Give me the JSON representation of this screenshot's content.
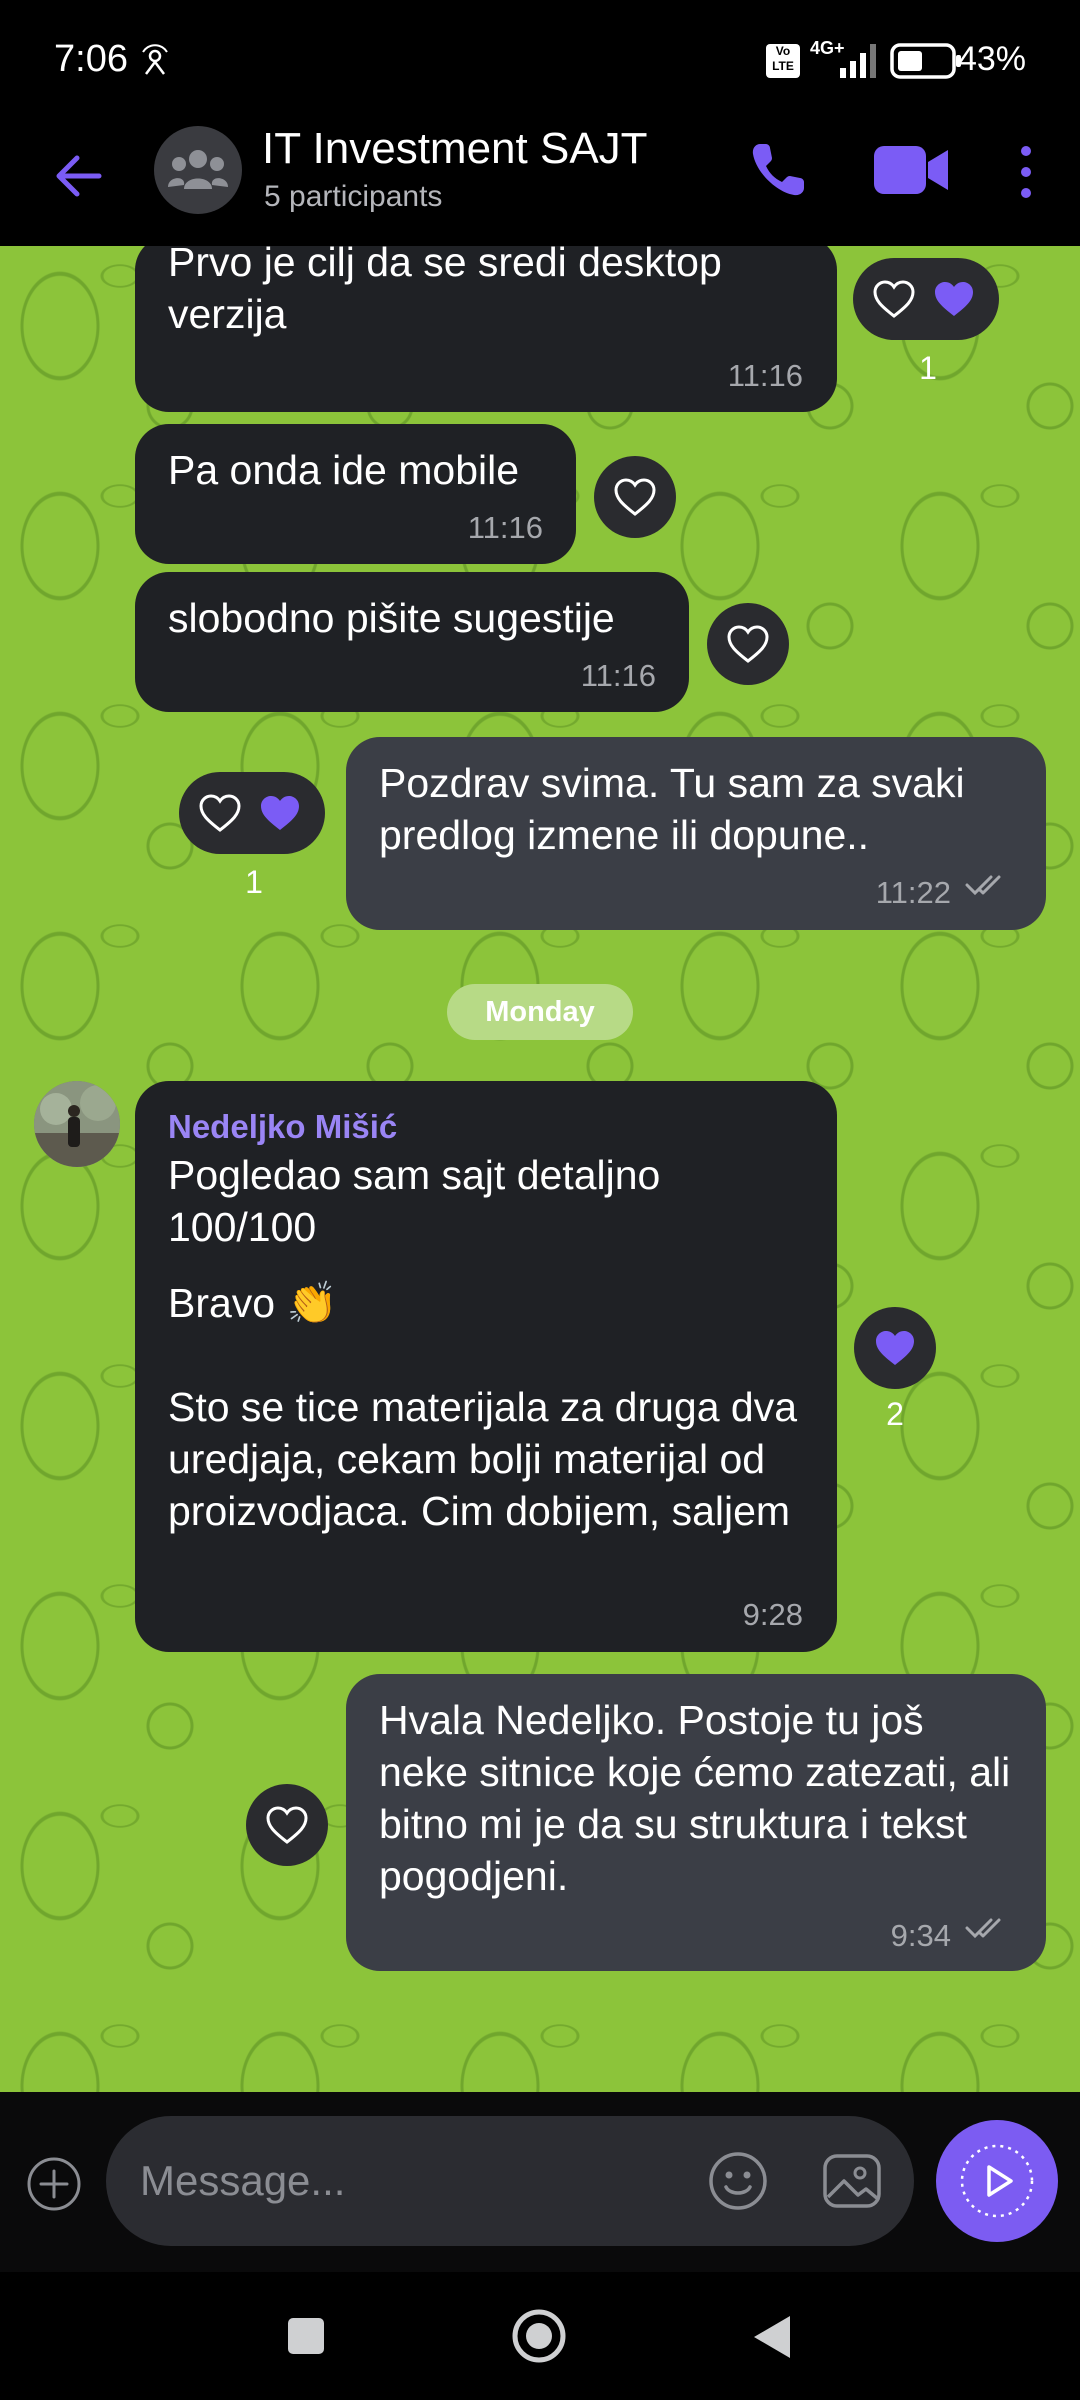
{
  "status_bar": {
    "time": "7:06",
    "network": "4G+",
    "volte": "Vo LTE",
    "battery_percent": "43%"
  },
  "header": {
    "title": "IT Investment SAJT",
    "subtitle": "5 participants",
    "back_icon": "arrow-left-icon",
    "call_icon": "phone-icon",
    "video_icon": "video-camera-icon",
    "more_icon": "vertical-dots-icon",
    "accent_color": "#7b5cf5"
  },
  "messages": [
    {
      "direction": "incoming",
      "text": "Prvo je cilj da se sredi desktop verzija",
      "time": "11:16",
      "reactions": {
        "liked": true,
        "count": "1"
      }
    },
    {
      "direction": "incoming",
      "text": "Pa onda ide mobile",
      "time": "11:16",
      "reactions": {
        "liked": false
      }
    },
    {
      "direction": "incoming",
      "text": "slobodno pišite sugestije",
      "time": "11:16",
      "reactions": {
        "liked": false
      }
    },
    {
      "direction": "outgoing",
      "text": "Pozdrav svima. Tu sam za svaki predlog izmene ili dopune..",
      "time": "11:22",
      "read": true,
      "reactions": {
        "liked": true,
        "count": "1"
      }
    },
    {
      "direction": "incoming",
      "sender": "Nedeljko Mišić",
      "text": "Pogledao sam sajt detaljno\n100/100",
      "text2": "Bravo 👏",
      "text3": "Sto se tice materijala za druga dva uredjaja, cekam bolji materijal od proizvodjaca. Cim dobijem, saljem",
      "time": "9:28",
      "reactions": {
        "liked": true,
        "count": "2"
      }
    },
    {
      "direction": "outgoing",
      "text": "Hvala Nedeljko. Postoje tu još neke sitnice koje ćemo zatezati, ali bitno mi je da su struktura i tekst pogodjeni.",
      "time": "9:34",
      "read": true,
      "reactions": {
        "liked": false
      }
    }
  ],
  "day_separator": "Monday",
  "composer": {
    "placeholder": "Message...",
    "attach_icon": "plus-circle-icon",
    "emoji_icon": "smiley-icon",
    "gallery_icon": "image-icon",
    "send_icon": "play-circle-icon",
    "send_color": "#7c5cf2"
  },
  "wallpaper_color": "#8cc43a",
  "nav": {
    "recents_icon": "square-icon",
    "home_icon": "circle-icon",
    "back_icon": "triangle-back-icon"
  }
}
